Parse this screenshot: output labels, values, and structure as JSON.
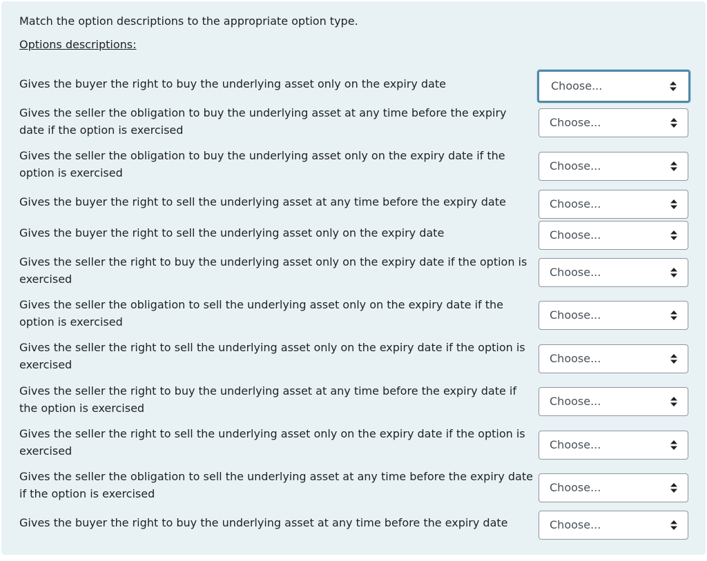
{
  "question": {
    "prompt": "Match the option descriptions to the appropriate option type.",
    "subheading": "Options descriptions:"
  },
  "select_placeholder": "Choose...",
  "caret_icon": "up-down-caret-icon",
  "focus_color": "#4f88a6",
  "rows": [
    {
      "text": "Gives the buyer the right to buy the underlying asset only on the expiry date",
      "value": "Choose..."
    },
    {
      "text": "Gives the seller the obligation to buy the underlying asset at any time before the expiry date if the option is exercised",
      "value": "Choose..."
    },
    {
      "text": "Gives the seller the obligation to buy the underlying asset only on the expiry date if the option is exercised",
      "value": "Choose..."
    },
    {
      "text": "Gives the buyer the right to sell the underlying asset at any time before the expiry date",
      "value": "Choose..."
    },
    {
      "text": "Gives the buyer the right to sell the underlying asset only on the expiry date",
      "value": "Choose..."
    },
    {
      "text": "Gives the seller the right to buy the underlying asset only on the expiry date if the option is exercised",
      "value": "Choose..."
    },
    {
      "text": "Gives the seller the obligation to sell the underlying asset only on the expiry date if the option is exercised",
      "value": "Choose..."
    },
    {
      "text": "Gives the seller the right to sell the underlying asset only on the expiry date if the option is exercised",
      "value": "Choose..."
    },
    {
      "text": "Gives the seller the right to buy the underlying asset at any time before the expiry date if the option is exercised",
      "value": "Choose..."
    },
    {
      "text": "Gives the seller the right to sell the underlying asset only on the expiry date if the option is exercised",
      "value": "Choose..."
    },
    {
      "text": "Gives the seller the obligation to sell the underlying asset at any time before the expiry date if the option is exercised",
      "value": "Choose..."
    },
    {
      "text": "Gives the buyer the right to buy the underlying asset at any time before the expiry date",
      "value": "Choose..."
    }
  ]
}
